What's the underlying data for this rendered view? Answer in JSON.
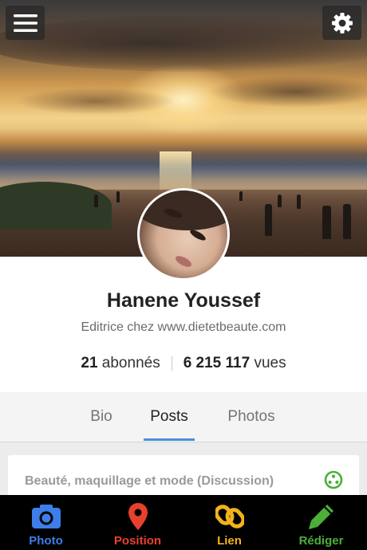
{
  "profile": {
    "name": "Hanene Youssef",
    "subtitle": "Editrice chez www.dietetbeaute.com",
    "followers_count": "21",
    "followers_label": "abonnés",
    "views_count": "6 215 117",
    "views_label": "vues"
  },
  "tabs": [
    {
      "label": "Bio",
      "active": false
    },
    {
      "label": "Posts",
      "active": true
    },
    {
      "label": "Photos",
      "active": false
    }
  ],
  "post": {
    "title": "Beauté, maquillage et mode (Discussion)"
  },
  "actions": [
    {
      "label": "Photo",
      "icon": "camera-icon",
      "color": "#3d7ee8"
    },
    {
      "label": "Position",
      "icon": "map-pin-icon",
      "color": "#e8402e"
    },
    {
      "label": "Lien",
      "icon": "link-icon",
      "color": "#f2b21c"
    },
    {
      "label": "Rédiger",
      "icon": "pencil-icon",
      "color": "#4caf3a"
    }
  ],
  "colors": {
    "accent": "#4a8fd6",
    "post_icon": "#4caf3a"
  }
}
